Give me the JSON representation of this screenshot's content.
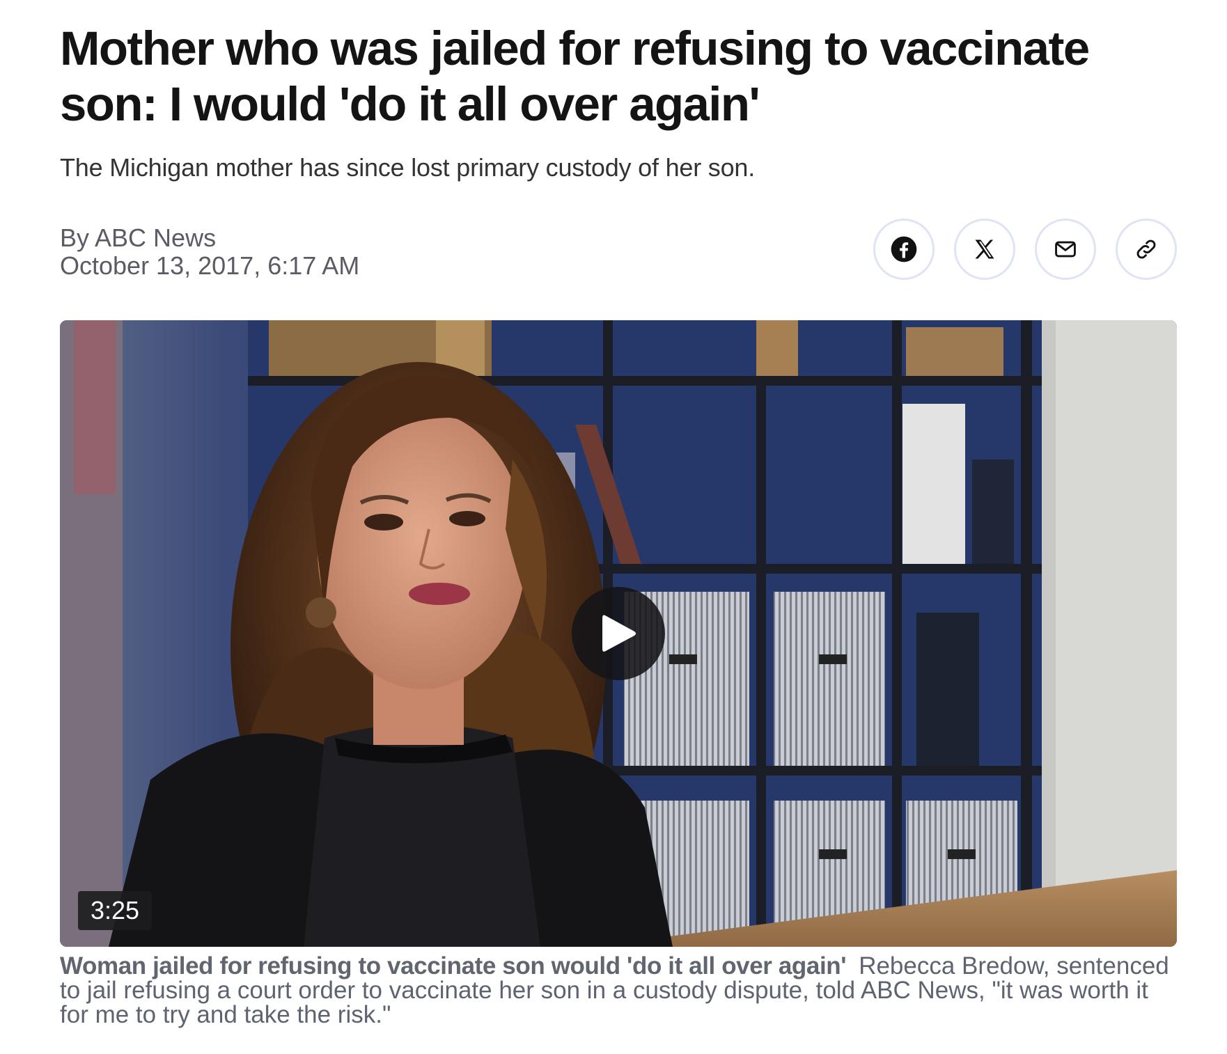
{
  "article": {
    "headline": "Mother who was jailed for refusing to vaccinate son: I would 'do it all over again'",
    "dek": "The Michigan mother has since lost primary custody of her son.",
    "byline": "By ABC News",
    "date": "October 13, 2017, 6:17 AM"
  },
  "share": {
    "buttons": [
      {
        "icon": "facebook-icon",
        "label": "Facebook"
      },
      {
        "icon": "x-icon",
        "label": "X"
      },
      {
        "icon": "mail-icon",
        "label": "Email"
      },
      {
        "icon": "link-icon",
        "label": "Copy link"
      }
    ]
  },
  "video": {
    "duration": "3:25",
    "play_icon": "play-icon"
  },
  "caption": {
    "title": "Woman jailed for refusing to vaccinate son would 'do it all over again'",
    "text": "Rebecca Bredow, sentenced to jail refusing a court order to vaccinate her son in a custody dispute, told ABC News, \"it was worth it for me to try and take the risk.\""
  },
  "colors": {
    "headline": "#141414",
    "meta": "#5b5b66",
    "share_border": "#dfe3f3",
    "caption": "#5d6371"
  }
}
